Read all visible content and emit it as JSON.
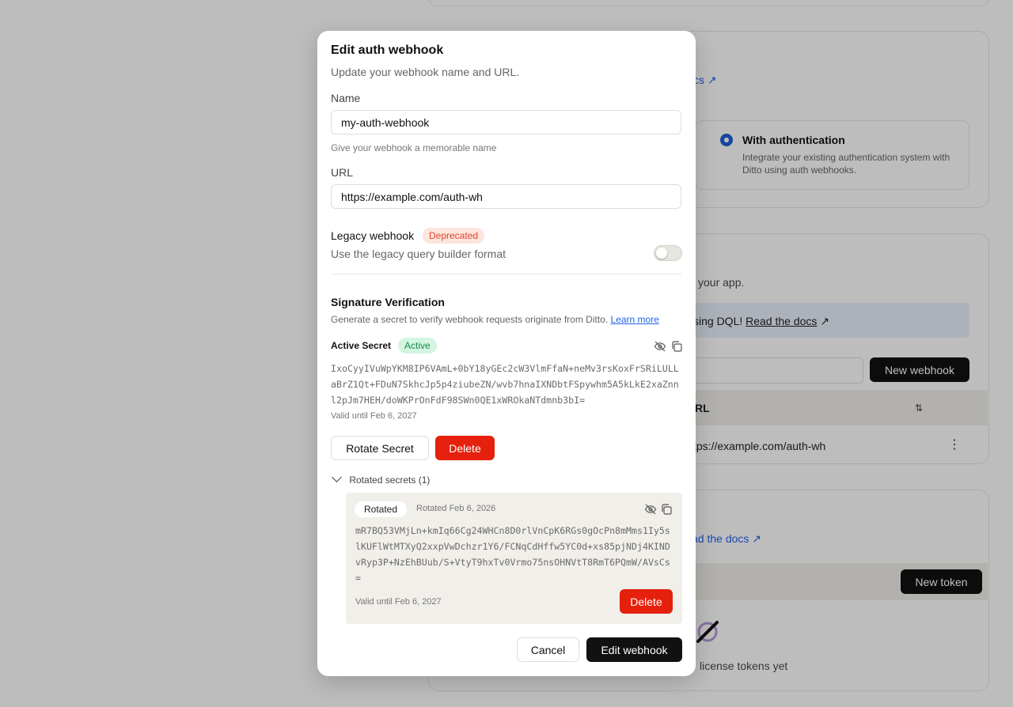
{
  "background": {
    "docs_link": "cs",
    "auth_option": {
      "title": "With authentication",
      "description": "Integrate your existing authentication system with Ditto using auth webhooks."
    },
    "webhooks_desc": "your app.",
    "dql_notice": "sing DQL!",
    "dql_link": "Read the docs",
    "new_webhook_button": "New webhook",
    "table_header_url": "RL",
    "table_row_url": "tps://example.com/auth-wh",
    "tokens_docs_link": "ad the docs",
    "new_token_button": "New token",
    "empty_tokens": "license tokens yet"
  },
  "modal": {
    "title": "Edit auth webhook",
    "subtitle": "Update your webhook name and URL.",
    "name_label": "Name",
    "name_value": "my-auth-webhook",
    "name_help": "Give your webhook a memorable name",
    "url_label": "URL",
    "url_value": "https://example.com/auth-wh",
    "legacy": {
      "label": "Legacy webhook",
      "badge": "Deprecated",
      "description": "Use the legacy query builder format",
      "enabled": false
    },
    "signature": {
      "title": "Signature Verification",
      "description": "Generate a secret to verify webhook requests originate from Ditto.",
      "learn_more": "Learn more",
      "active_label": "Active Secret",
      "active_badge": "Active",
      "active_secret": "IxoCyyIVuWpYKM8IP6VAmL+0bY18yGEc2cW3VlmFfaN+neMv3rsKoxFrSRiLULLaBrZ1Qt+FDuN7SkhcJp5p4ziubeZN/wvb7hnaIXNDbtFSpywhm5A5kLkE2xaZnnl2pJm7HEH/doWKPrOnFdF98SWn0QE1xWROkaNTdmnb3bI=",
      "active_valid": "Valid until Feb 6, 2027",
      "rotate_button": "Rotate Secret",
      "delete_button": "Delete",
      "rotated_toggle": "Rotated secrets (1)",
      "rotated": {
        "badge": "Rotated",
        "date": "Rotated Feb 6, 2026",
        "secret": "mR7BQ53VMjLn+kmIq66Cg24WHCn8D0rlVnCpK6RGs0gOcPn8mMms1Iy5slKUFlWtMTXyQ2xxpVwDchzr1Y6/FCNqCdHffw5YC0d+xs85pjNDj4KINDvRyp3P+NzEhBUub/S+VtyT9hxTv0Vrmo75nsOHNVtT8RmT6PQmW/AVsCs=",
        "valid": "Valid until Feb 6, 2027",
        "delete_button": "Delete"
      }
    },
    "cancel_button": "Cancel",
    "submit_button": "Edit webhook"
  },
  "colors": {
    "primary": "#111111",
    "danger": "#e5210e",
    "link": "#2463eb",
    "active_badge_bg": "#d3f5e1",
    "active_badge_text": "#1b8a4c",
    "deprecated_badge_bg": "#fde4dd",
    "deprecated_badge_text": "#e0452a"
  }
}
